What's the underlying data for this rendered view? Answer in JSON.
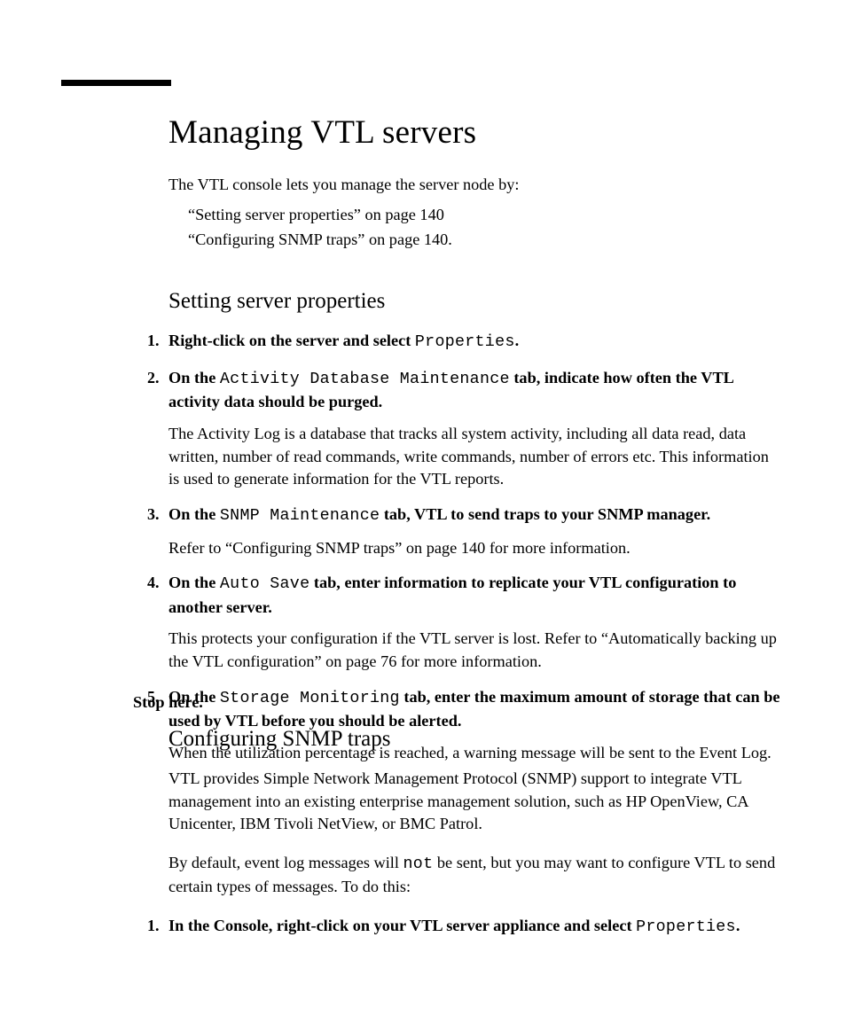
{
  "title": "Managing VTL servers",
  "intro_lead": "The VTL console lets you manage the server node by:",
  "intro_items": [
    "“Setting server properties” on page 140",
    "“Configuring SNMP traps” on page 140."
  ],
  "section1": {
    "heading": "Setting server properties",
    "steps": [
      {
        "head_pre": "Right-click on the server and select ",
        "head_mono": "Properties",
        "head_post": ".",
        "body": ""
      },
      {
        "head_pre": "On the ",
        "head_mono": "Activity Database Maintenance",
        "head_post": " tab, indicate how often the VTL activity data should be purged.",
        "body": "The Activity Log is a database that tracks all system activity, including all data read, data written, number of read commands, write commands, number of errors etc. This information is used to generate information for the VTL reports."
      },
      {
        "head_pre": "On the ",
        "head_mono": "SNMP Maintenance",
        "head_post": " tab, VTL to send traps to your SNMP manager.",
        "body": "Refer to “Configuring SNMP traps” on page 140 for more information."
      },
      {
        "head_pre": "On the ",
        "head_mono": "Auto Save",
        "head_post": " tab, enter information to replicate your VTL configuration to another server.",
        "body": "This protects your configuration if the VTL server is lost. Refer to “Automatically backing up the VTL configuration” on page 76 for more information."
      },
      {
        "head_pre": "On the ",
        "head_mono": "Storage Monitoring",
        "head_post": " tab, enter the maximum amount of storage that can be used by VTL before you should be alerted.",
        "body": "When the utilization percentage is reached, a warning message will be sent to the Event Log."
      }
    ]
  },
  "stop_text": "Stop here.",
  "section2": {
    "heading": "Configuring SNMP traps",
    "para1": "VTL provides Simple Network Management Protocol (SNMP) support to integrate VTL management into an existing enterprise management solution, such as HP OpenView, CA Unicenter, IBM Tivoli NetView, or BMC Patrol.",
    "para2_pre": "By default, event log messages will ",
    "para2_mono": "not",
    "para2_post": " be sent, but you may want to configure VTL to send certain types of messages. To do this:",
    "steps": [
      {
        "head_pre": "In the Console, right-click on your VTL server appliance and select ",
        "head_mono": "Properties",
        "head_post": "."
      }
    ]
  }
}
